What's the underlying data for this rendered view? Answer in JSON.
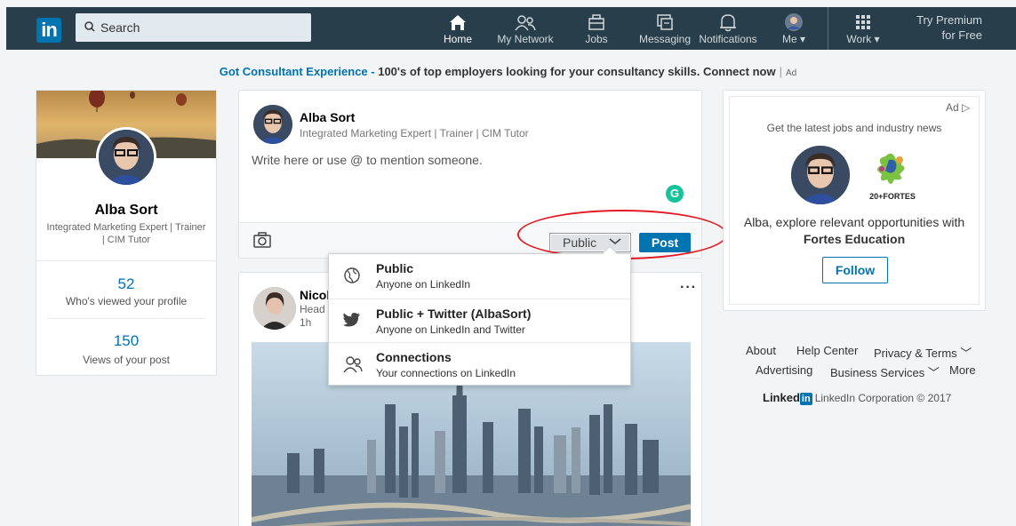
{
  "nav": {
    "logo": "in",
    "search_placeholder": "Search",
    "items": [
      {
        "label": "Home",
        "icon": "home-icon",
        "active": true
      },
      {
        "label": "My Network",
        "icon": "network-icon"
      },
      {
        "label": "Jobs",
        "icon": "briefcase-icon"
      },
      {
        "label": "Messaging",
        "icon": "messaging-icon"
      },
      {
        "label": "Notifications",
        "icon": "bell-icon"
      },
      {
        "label": "Me",
        "icon": "avatar"
      },
      {
        "label": "Work",
        "icon": "grid-icon"
      }
    ],
    "premium_line1": "Try Premium",
    "premium_line2": "for Free"
  },
  "ad_banner": {
    "highlight": "Got Consultant Experience - ",
    "text": "100's of top employers looking for your consultancy skills. Connect now",
    "separator": "|",
    "tag": "Ad"
  },
  "profile": {
    "name": "Alba Sort",
    "headline": "Integrated Marketing Expert | Trainer | CIM Tutor",
    "stats": [
      {
        "value": "52",
        "label": "Who's viewed your profile"
      },
      {
        "value": "150",
        "label": "Views of your post"
      }
    ]
  },
  "composer": {
    "name": "Alba Sort",
    "headline": "Integrated Marketing Expert | Trainer | CIM Tutor",
    "placeholder": "Write here or use @ to mention someone.",
    "grammarly": "G",
    "visibility": "Public",
    "post_label": "Post"
  },
  "visibility_menu": [
    {
      "title": "Public",
      "subtitle": "Anyone on LinkedIn",
      "icon": "globe-icon"
    },
    {
      "title": "Public + Twitter (AlbaSort)",
      "subtitle": "Anyone on LinkedIn and Twitter",
      "icon": "twitter-icon"
    },
    {
      "title": "Connections",
      "subtitle": "Your connections on LinkedIn",
      "icon": "connections-icon"
    }
  ],
  "feed_post": {
    "name": "Nicole",
    "headline": "Head o",
    "time": "1h",
    "more": "···"
  },
  "right_ad": {
    "label": "Ad",
    "title": "Get the latest jobs and industry news",
    "desc": "Alba, explore relevant opportunities with",
    "company": "Fortes Education",
    "follow": "Follow",
    "logo_text": "20+FORTES"
  },
  "footer": {
    "links": [
      "About",
      "Help Center",
      "Privacy & Terms",
      "Advertising",
      "Business Services",
      "More"
    ],
    "brand_word": "Linked",
    "brand_in": "in",
    "copyright": "LinkedIn Corporation © 2017"
  },
  "colors": {
    "nav_bg": "#283e4a",
    "brand": "#0073b1",
    "highlight_ellipse": "#e31b23",
    "grammarly": "#15c39a"
  }
}
